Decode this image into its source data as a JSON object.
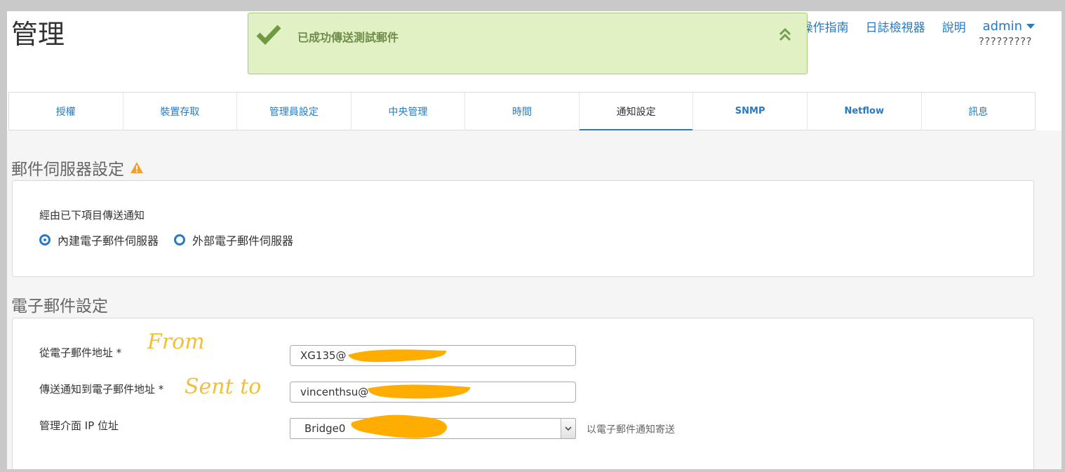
{
  "header": {
    "title": "管理",
    "links": {
      "guide": "操作指南",
      "log_viewer": "日誌檢視器",
      "help": "說明",
      "user": "admin"
    },
    "device_name": "?????????"
  },
  "toast": {
    "message": "已成功傳送測試郵件",
    "status": "success"
  },
  "tabs": [
    {
      "label": "授權"
    },
    {
      "label": "裝置存取"
    },
    {
      "label": "管理員設定"
    },
    {
      "label": "中央管理"
    },
    {
      "label": "時間"
    },
    {
      "label": "通知設定",
      "active": true
    },
    {
      "label": "SNMP"
    },
    {
      "label": "Netflow"
    },
    {
      "label": "訊息"
    }
  ],
  "mail_server": {
    "title": "郵件伺服器設定",
    "send_via_label": "經由已下項目傳送通知",
    "options": [
      "內建電子郵件伺服器",
      "外部電子郵件伺服器"
    ],
    "selected": "內建電子郵件伺服器"
  },
  "email_settings": {
    "title": "電子郵件設定",
    "from_label": "從電子郵件地址 *",
    "from_value": "XG135@",
    "to_label": "傳送通知到電子郵件地址 *",
    "to_value": "vincenthsu@",
    "ip_label": "管理介面 IP 位址",
    "ip_value": "Bridge0",
    "ip_hint": "以電子郵件通知寄送"
  },
  "annotations": {
    "from": "From",
    "sent_to": "Sent to"
  },
  "colors": {
    "accent": "#2a7ac0",
    "toast_bg": "#e2f1c4",
    "toast_text": "#6e8c4a",
    "redaction": "#ffad00",
    "warning": "#f0a030"
  }
}
